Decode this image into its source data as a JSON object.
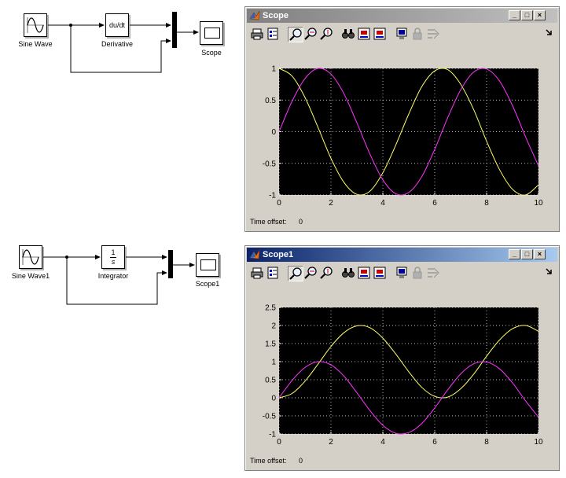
{
  "diagram1": {
    "source_label": "Sine Wave",
    "derivative_block": "du/dt",
    "derivative_label": "Derivative",
    "scope_label": "Scope"
  },
  "diagram2": {
    "source_label": "Sine Wave1",
    "integrator_num": "1",
    "integrator_den": "s",
    "integrator_label": "Integrator",
    "scope_label": "Scope1"
  },
  "scope_windows": [
    {
      "title": "Scope",
      "time_offset_label": "Time offset:",
      "time_offset_value": "0",
      "y_ticks": [
        "1",
        "0.5",
        "0",
        "-0.5",
        "-1"
      ],
      "x_ticks": [
        "0",
        "2",
        "4",
        "6",
        "8",
        "10"
      ]
    },
    {
      "title": "Scope1",
      "time_offset_label": "Time offset:",
      "time_offset_value": "0",
      "y_ticks": [
        "2.5",
        "2",
        "1.5",
        "1",
        "0.5",
        "0",
        "-0.5",
        "-1"
      ],
      "x_ticks": [
        "0",
        "2",
        "4",
        "6",
        "8",
        "10"
      ]
    }
  ],
  "toolbar_icons": [
    "print-icon",
    "parameters-icon",
    "zoom-icon",
    "zoom-x-icon",
    "zoom-y-icon",
    "autoscale-icon",
    "save-axes-icon",
    "restore-axes-icon",
    "floating-scope-icon",
    "lock-axes-icon",
    "signal-selection-icon"
  ],
  "colors": {
    "trace_yellow": "#ffff66",
    "trace_magenta": "#ff33ff",
    "plot_bg": "#000000",
    "title_active": "#0a246a",
    "title_inactive": "#808080"
  },
  "chart_data": [
    {
      "type": "line",
      "title": "",
      "xlim": [
        0,
        10
      ],
      "ylim": [
        -1,
        1
      ],
      "x_ticks": [
        0,
        2,
        4,
        6,
        8,
        10
      ],
      "y_ticks": [
        -1,
        -0.5,
        0,
        0.5,
        1
      ],
      "grid": true,
      "series": [
        {
          "color": "#ffff66",
          "x": [
            0,
            0.5,
            1,
            1.5,
            2,
            2.5,
            3,
            3.5,
            4,
            4.5,
            5,
            5.5,
            6,
            6.5,
            7,
            7.5,
            8,
            8.5,
            9,
            9.5,
            10
          ],
          "y": [
            1,
            0.88,
            0.54,
            0.07,
            -0.42,
            -0.8,
            -0.99,
            -0.94,
            -0.65,
            -0.21,
            0.28,
            0.71,
            0.96,
            0.98,
            0.75,
            0.35,
            -0.15,
            -0.6,
            -0.91,
            -1,
            -0.84
          ]
        },
        {
          "color": "#ff33ff",
          "x": [
            0,
            0.5,
            1,
            1.5,
            2,
            2.5,
            3,
            3.5,
            4,
            4.5,
            5,
            5.5,
            6,
            6.5,
            7,
            7.5,
            8,
            8.5,
            9,
            9.5,
            10
          ],
          "y": [
            0,
            0.48,
            0.84,
            1,
            0.91,
            0.6,
            0.14,
            -0.35,
            -0.76,
            -0.98,
            -0.96,
            -0.71,
            -0.28,
            0.22,
            0.66,
            0.94,
            0.99,
            0.8,
            0.41,
            -0.08,
            -0.54
          ]
        }
      ]
    },
    {
      "type": "line",
      "title": "",
      "xlim": [
        0,
        10
      ],
      "ylim": [
        -1,
        2.5
      ],
      "x_ticks": [
        0,
        2,
        4,
        6,
        8,
        10
      ],
      "y_ticks": [
        -1,
        -0.5,
        0,
        0.5,
        1,
        1.5,
        2,
        2.5
      ],
      "grid": true,
      "series": [
        {
          "color": "#ffff66",
          "x": [
            0,
            0.5,
            1,
            1.5,
            2,
            2.5,
            3,
            3.5,
            4,
            4.5,
            5,
            5.5,
            6,
            6.5,
            7,
            7.5,
            8,
            8.5,
            9,
            9.5,
            10
          ],
          "y": [
            0,
            0.12,
            0.46,
            0.93,
            1.42,
            1.8,
            1.99,
            1.94,
            1.65,
            1.21,
            0.72,
            0.29,
            0.04,
            0.02,
            0.25,
            0.65,
            1.15,
            1.6,
            1.91,
            2,
            1.84
          ]
        },
        {
          "color": "#ff33ff",
          "x": [
            0,
            0.5,
            1,
            1.5,
            2,
            2.5,
            3,
            3.5,
            4,
            4.5,
            5,
            5.5,
            6,
            6.5,
            7,
            7.5,
            8,
            8.5,
            9,
            9.5,
            10
          ],
          "y": [
            0,
            0.48,
            0.84,
            1,
            0.91,
            0.6,
            0.14,
            -0.35,
            -0.76,
            -0.98,
            -0.96,
            -0.71,
            -0.28,
            0.22,
            0.66,
            0.94,
            0.99,
            0.8,
            0.41,
            -0.08,
            -0.54
          ]
        }
      ]
    }
  ]
}
